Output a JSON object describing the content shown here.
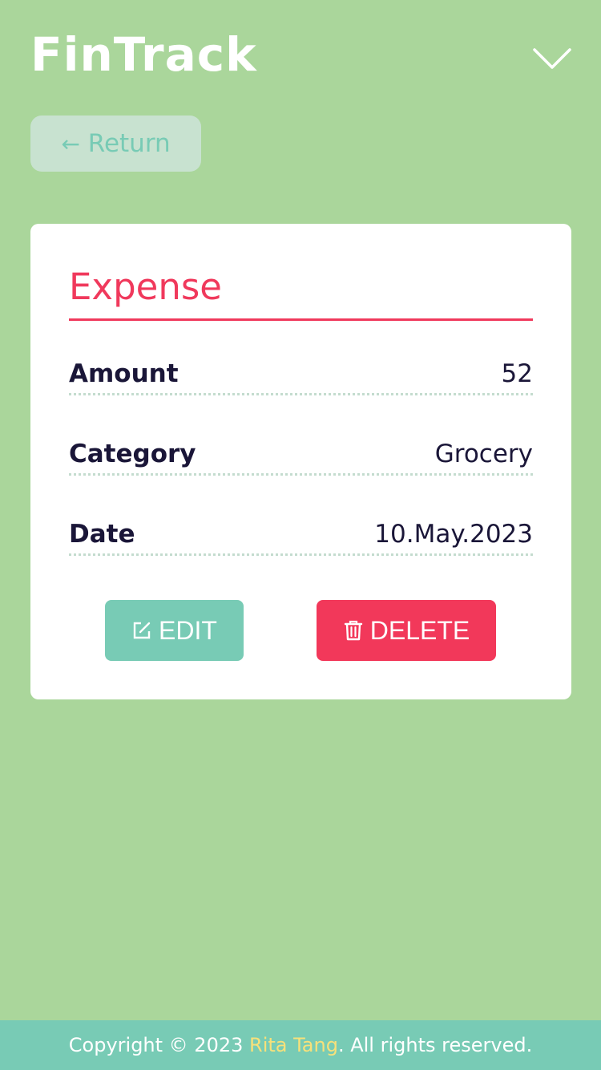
{
  "header": {
    "brand": "FinTrack",
    "menu_icon": "chevron-down-icon"
  },
  "nav": {
    "return_arrow": "←",
    "return_label": "Return"
  },
  "record": {
    "title": "Expense",
    "fields": [
      {
        "label": "Amount",
        "value": "52"
      },
      {
        "label": "Category",
        "value": "Grocery"
      },
      {
        "label": "Date",
        "value": "10.May.2023"
      }
    ],
    "actions": {
      "edit_label": "EDIT",
      "edit_icon": "edit-icon",
      "delete_label": "DELETE",
      "delete_icon": "trash-icon"
    }
  },
  "footer": {
    "prefix": "Copyright © 2023 ",
    "author": "Rita Tang",
    "suffix": ". All rights reserved."
  },
  "colors": {
    "background": "#aad69b",
    "accent_teal": "#78cbb5",
    "accent_red": "#f0395c",
    "text_dark": "#1a1638",
    "author_yellow": "#f7e17a"
  }
}
